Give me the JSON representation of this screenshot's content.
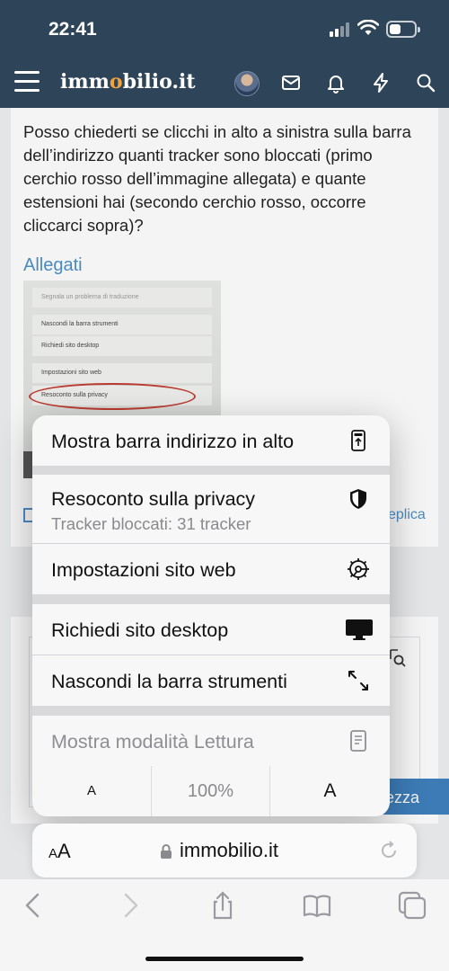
{
  "status_bar": {
    "time": "22:41"
  },
  "site_header": {
    "logo_pre": "imm",
    "logo_mid": "o",
    "logo_post": "bilio.it"
  },
  "post": {
    "text": "Posso chiederti se clicchi in alto a sinistra sulla barra dell’indirizzo quanti tracker sono bloccati (primo cerchio rosso dell’immagine allegata) e quante estensioni hai (secondo cerchio rosso, occorre cliccarci sopra)?",
    "attachments_label": "Allegati",
    "reply_fragment": "eplica",
    "button_fragment": "tezza"
  },
  "attachment_thumbnail": {
    "rows": [
      "Segnala un problema di traduzione",
      "Nascondi la barra strumenti",
      "Richiedi sito desktop",
      "Impostazioni sito web",
      "Resoconto sulla privacy"
    ]
  },
  "menu": {
    "items": [
      {
        "label": "Mostra barra indirizzo in alto",
        "icon": "address-bar-top-icon"
      },
      {
        "label": "Resoconto sulla privacy",
        "sub": "Tracker bloccati: 31 tracker",
        "icon": "shield-icon"
      },
      {
        "label": "Impostazioni sito web",
        "icon": "gear-icon"
      },
      {
        "label": "Richiedi sito desktop",
        "icon": "desktop-icon"
      },
      {
        "label": "Nascondi la barra strumenti",
        "icon": "expand-arrows-icon"
      },
      {
        "label": "Mostra modalità Lettura",
        "icon": "reader-icon"
      }
    ],
    "zoom": {
      "smaller": "A",
      "level": "100%",
      "larger": "A"
    }
  },
  "address_bar": {
    "aa_small": "A",
    "aa_large": "A",
    "url": "immobilio.it"
  },
  "colors": {
    "header": "#2e4458",
    "link": "#4a8fc9",
    "accent_logo": "#f2a23a",
    "button": "#3c7fbd"
  }
}
